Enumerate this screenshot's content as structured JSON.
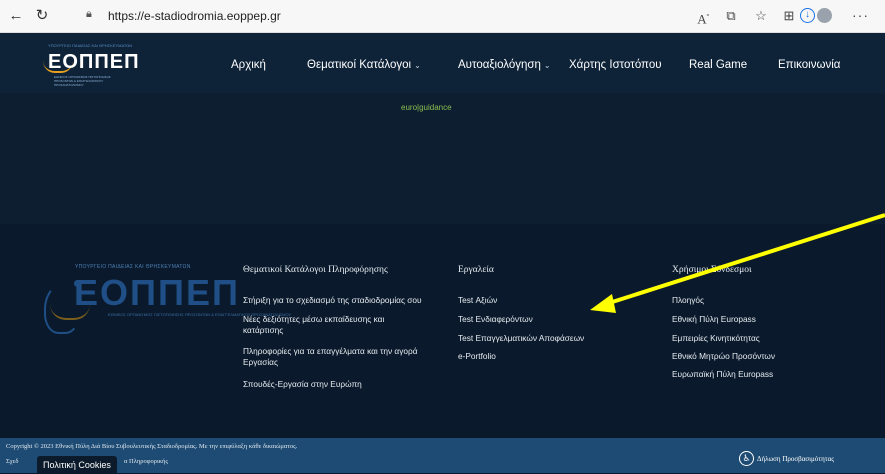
{
  "browser": {
    "url": "https://e-stadiodromia.eoppep.gr",
    "reader_glyph": "A",
    "reader_sup": "ⁿ"
  },
  "header": {
    "logo_topline": "ΥΠΟΥΡΓΕΙΟ ΠΑΙΔΕΙΑΣ ΚΑΙ ΘΡΗΣΚΕΥΜΑΤΩΝ",
    "logo_mark": "ΕΟΠΠΕΠ",
    "logo_sub": "ΕΘΝΙΚΟΣ ΟΡΓΑΝΙΣΜΟΣ ΠΙΣΤΟΠΟΙΗΣΗΣ ΠΡΟΣΟΝΤΩΝ & ΕΠΑΓΓΕΛΜΑΤΙΚΟΥ ΠΡΟΣΑΝΑΤΟΛΙΣΜΟΥ",
    "menu": [
      {
        "label": "Αρχική",
        "has_caret": false
      },
      {
        "label": "Θεματικοί Κατάλογοι",
        "has_caret": true
      },
      {
        "label": "Αυτοαξιολόγηση",
        "has_caret": true
      },
      {
        "label": "Χάρτης Ιστοτόπου",
        "has_caret": false
      },
      {
        "label": "Real Game",
        "has_caret": false
      },
      {
        "label": "Επικοινωνία",
        "has_caret": false
      }
    ],
    "caret": "⌄"
  },
  "hero": {
    "guidance": "euro|guidance"
  },
  "footer": {
    "columns": [
      {
        "title": "Θεματικοί Κατάλογοι Πληροφόρησης",
        "links": [
          "Στήριξη για το σχεδιασμό της σταδιοδρομίας σου",
          "Νέες δεξιότητες μέσω εκπαίδευσης και κατάρτισης",
          "Πληροφορίες για τα επαγγέλματα και την αγορά Εργασίας",
          "Σπουδές-Εργασία στην Ευρώπη"
        ]
      },
      {
        "title": "Εργαλεία",
        "links": [
          "Test Αξιών",
          "Test Ενδιαφερόντων",
          "Test Επαγγελματικών Αποφάσεων",
          "e-Portfolio"
        ]
      },
      {
        "title": "Χρήσιμοι Σύνδεσμοι",
        "links": [
          "Πλοηγός",
          "Εθνική Πύλη Europass",
          "Εμπειρίες Κινητικότητας",
          "Εθνικό Μητρώο Προσόντων",
          "Ευρωπαϊκή Πύλη Europass"
        ]
      }
    ]
  },
  "bottom": {
    "copyright": "Copyright © 2023 Εθνική Πύλη Διά Βίου Συβουλευτικής Σταδιοδρομίας. Με την επιφύλαξη κάθε δικαιώματος.",
    "schedio": "Σχεδ",
    "cookies": "Πολιτική Cookies",
    "info": "α Πληροφορικής",
    "accessibility": "Δήλωση Προσβασιμότητας"
  },
  "annotation": {
    "arrow_color": "#ffff00"
  }
}
